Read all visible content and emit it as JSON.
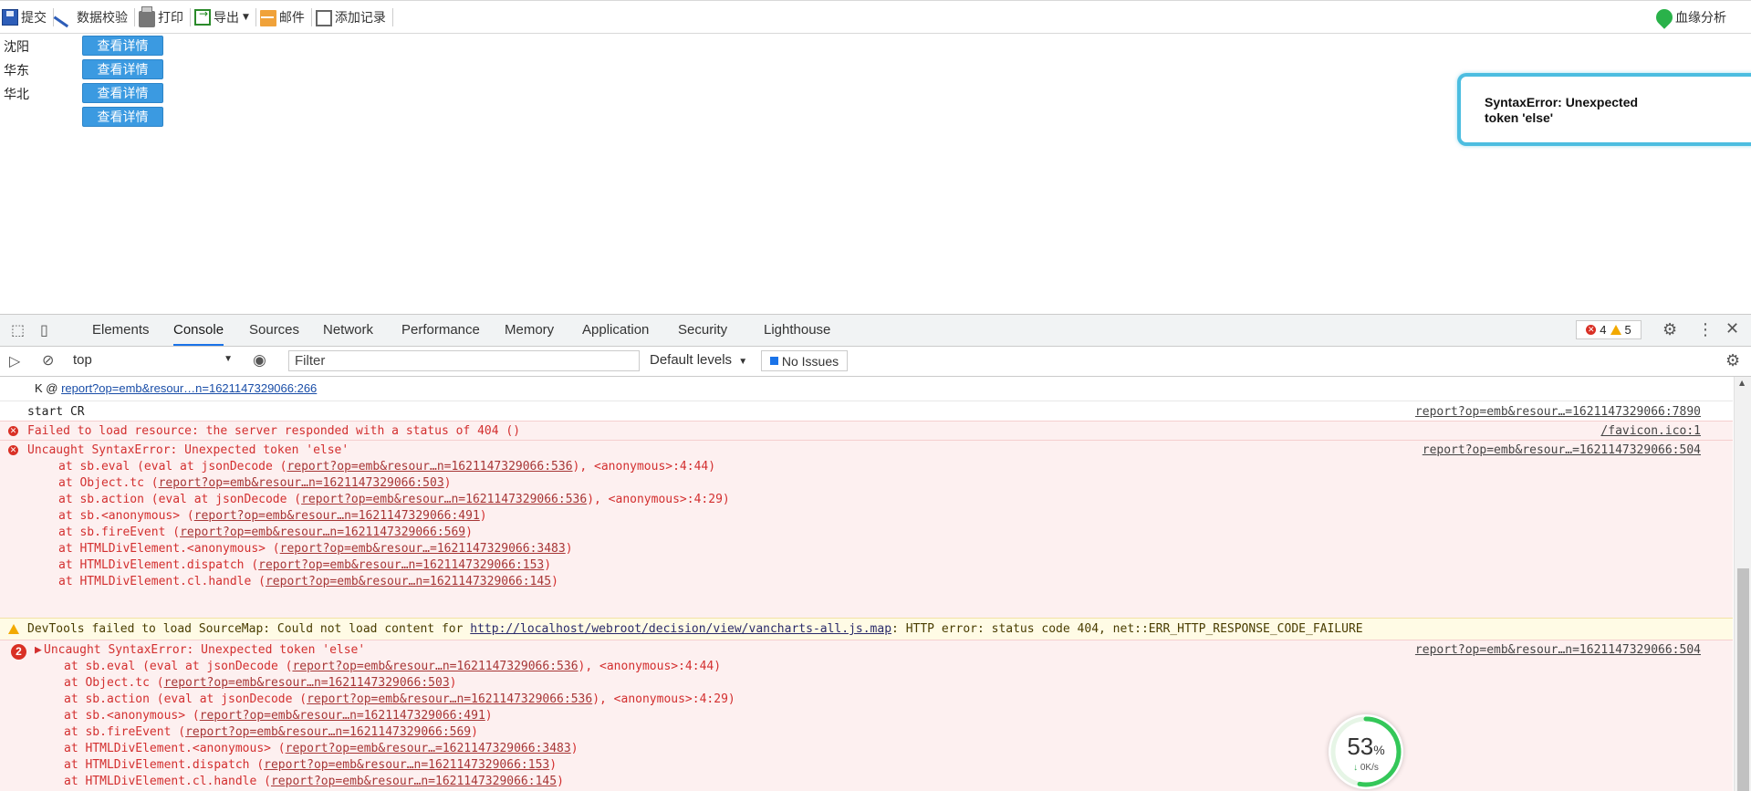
{
  "toolbar": {
    "submit": "提交",
    "validate": "数据校验",
    "print": "打印",
    "export": "导出",
    "mail": "邮件",
    "add_record": "添加记录",
    "lineage": "血缘分析"
  },
  "report": {
    "regions": [
      "沈阳",
      "华东",
      "华北"
    ],
    "detail_label": "查看详情"
  },
  "toast": {
    "message": "SyntaxError: Unexpected token 'else'"
  },
  "devtools": {
    "tabs": [
      "Elements",
      "Console",
      "Sources",
      "Network",
      "Performance",
      "Memory",
      "Application",
      "Security",
      "Lighthouse"
    ],
    "active_tab": "Console",
    "error_count": "4",
    "warning_count": "5",
    "context": "top",
    "filter_placeholder": "Filter",
    "levels": "Default levels",
    "no_issues": "No Issues"
  },
  "console": {
    "k_line_prefix": "K @ ",
    "k_line_link": "report?op=emb&resour…n=1621147329066:266",
    "log_text": "start CR",
    "log_src": "report?op=emb&resour…=1621147329066:7890",
    "err404_text": "Failed to load resource: the server responded with a status of 404 ()",
    "err404_src": "/favicon.ico:1",
    "err1_title": "Uncaught SyntaxError: Unexpected token 'else'",
    "err1_src": "report?op=emb&resour…=1621147329066:504",
    "err2_badge": "2",
    "err2_title": "Uncaught SyntaxError: Unexpected token 'else'",
    "err2_src": "report?op=emb&resour…n=1621147329066:504",
    "stack": [
      {
        "pre": "at sb.eval (eval at jsonDecode (",
        "link": "report?op=emb&resour…n=1621147329066:536",
        "post": "), <anonymous>:4:44)"
      },
      {
        "pre": "at Object.tc (",
        "link": "report?op=emb&resour…n=1621147329066:503",
        "post": ")"
      },
      {
        "pre": "at sb.action (eval at jsonDecode (",
        "link": "report?op=emb&resour…n=1621147329066:536",
        "post": "), <anonymous>:4:29)"
      },
      {
        "pre": "at sb.<anonymous> (",
        "link": "report?op=emb&resour…n=1621147329066:491",
        "post": ")"
      },
      {
        "pre": "at sb.fireEvent (",
        "link": "report?op=emb&resour…n=1621147329066:569",
        "post": ")"
      },
      {
        "pre": "at HTMLDivElement.<anonymous> (",
        "link": "report?op=emb&resour…=1621147329066:3483",
        "post": ")"
      },
      {
        "pre": "at HTMLDivElement.dispatch (",
        "link": "report?op=emb&resour…n=1621147329066:153",
        "post": ")"
      },
      {
        "pre": "at HTMLDivElement.cl.handle (",
        "link": "report?op=emb&resour…n=1621147329066:145",
        "post": ")"
      }
    ],
    "warn_pre": "DevTools failed to load SourceMap: Could not load content for ",
    "warn_link": "http://localhost/webroot/decision/view/vancharts-all.js.map",
    "warn_post": ": HTTP error: status code 404, net::ERR_HTTP_RESPONSE_CODE_FAILURE"
  },
  "gauge": {
    "value": 53,
    "value_text": "53",
    "unit": "%",
    "rate": "0K/s"
  },
  "colors": {
    "accent": "#1a73e8",
    "error": "#d93025",
    "button": "#3b9ae1",
    "toast_border": "#4cbde0"
  }
}
